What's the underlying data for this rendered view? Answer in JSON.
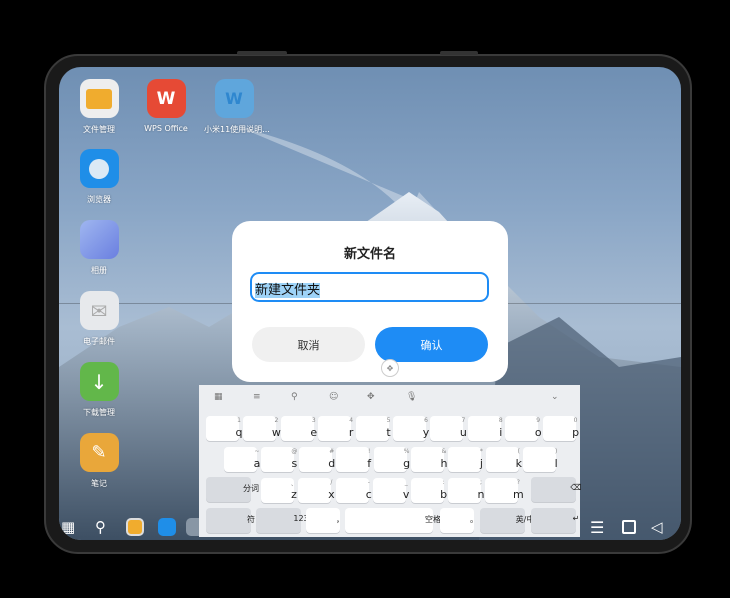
{
  "desktop": {
    "apps": [
      {
        "label": "文件管理",
        "icon": "folder-icon"
      },
      {
        "label": "WPS Office",
        "icon": "wps-icon"
      },
      {
        "label": "小米11使用说明...",
        "icon": "word-doc-icon"
      },
      {
        "label": "浏览器",
        "icon": "browser-icon"
      },
      {
        "label": "相册",
        "icon": "gallery-icon"
      },
      {
        "label": "电子邮件",
        "icon": "mail-icon"
      },
      {
        "label": "下载管理",
        "icon": "download-icon"
      },
      {
        "label": "笔记",
        "icon": "notes-icon"
      }
    ]
  },
  "dialog": {
    "title": "新文件名",
    "input_value": "新建文件夹",
    "cancel_label": "取消",
    "confirm_label": "确认",
    "accent": "#1e8cf5"
  },
  "keyboard": {
    "toolbar": [
      "grid-icon",
      "menu-icon",
      "search-icon",
      "emoji-icon",
      "cursor-move-icon",
      "microphone-icon",
      "collapse-chevron-icon"
    ],
    "row1": [
      [
        "q",
        "1"
      ],
      [
        "w",
        "2"
      ],
      [
        "e",
        "3"
      ],
      [
        "r",
        "4"
      ],
      [
        "t",
        "5"
      ],
      [
        "y",
        "6"
      ],
      [
        "u",
        "7"
      ],
      [
        "i",
        "8"
      ],
      [
        "o",
        "9"
      ],
      [
        "p",
        "0"
      ]
    ],
    "row2": [
      [
        "a",
        "~"
      ],
      [
        "s",
        "@"
      ],
      [
        "d",
        "#"
      ],
      [
        "f",
        "!"
      ],
      [
        "g",
        "%"
      ],
      [
        "h",
        "&"
      ],
      [
        "j",
        "*"
      ],
      [
        "k",
        "("
      ],
      [
        "l",
        ")"
      ]
    ],
    "row3_left": "分词",
    "row3": [
      [
        "z",
        "、"
      ],
      [
        "x",
        "/"
      ],
      [
        "c",
        "-"
      ],
      [
        "v",
        "_"
      ],
      [
        "b",
        ":"
      ],
      [
        "n",
        ";"
      ],
      [
        "m",
        "?"
      ]
    ],
    "row4": {
      "symbols": "符",
      "numbers": "123",
      "comma": "，",
      "space": "空格",
      "period": "。",
      "lang": "英/中"
    }
  },
  "taskbar": {
    "left": [
      "app-drawer-icon",
      "search-icon",
      "file-manager-icon",
      "browser-icon",
      "settings-icon"
    ],
    "right": [
      "menu-icon",
      "home-square-icon",
      "back-triangle-icon"
    ]
  }
}
